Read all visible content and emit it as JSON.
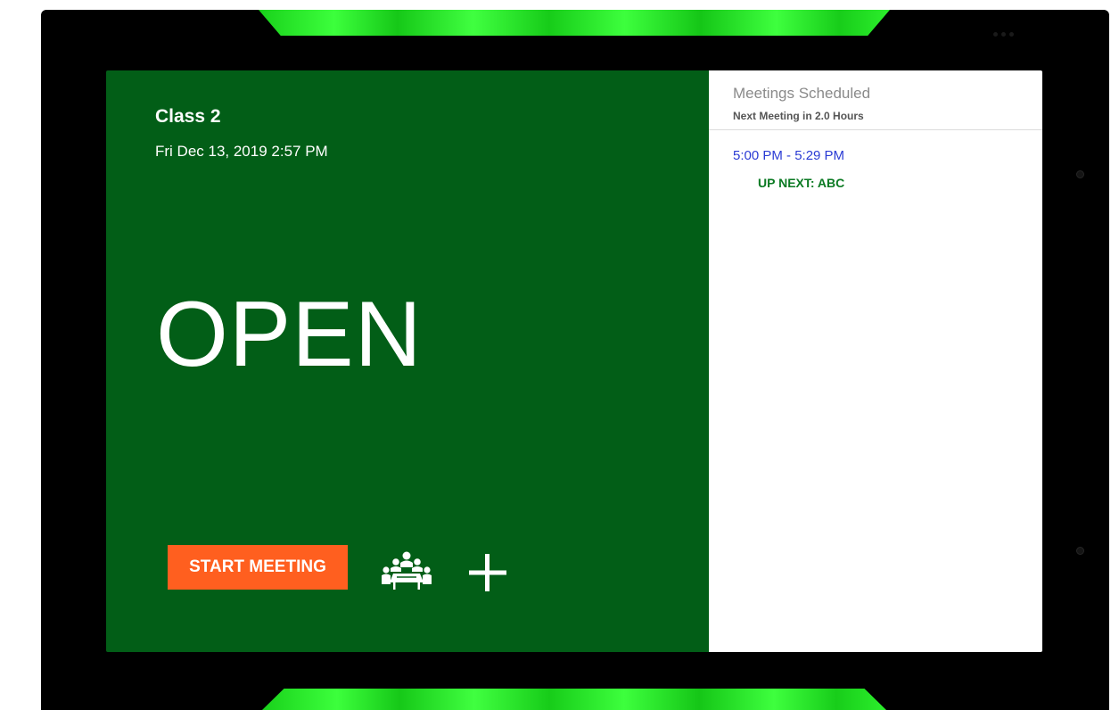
{
  "room": {
    "name": "Class 2",
    "datetime": "Fri Dec 13, 2019 2:57 PM",
    "status": "OPEN"
  },
  "actions": {
    "start_meeting_label": "START MEETING"
  },
  "icons": {
    "attendees": "meeting-attendees-icon",
    "add": "plus-icon"
  },
  "schedule": {
    "title": "Meetings Scheduled",
    "next_meeting": "Next Meeting in 2.0 Hours",
    "meetings": [
      {
        "time": "5:00 PM - 5:29 PM",
        "label": "UP NEXT: ABC"
      }
    ]
  },
  "colors": {
    "status_background": "#025e17",
    "start_button": "#ff5f1f",
    "led": "#2ef02e",
    "meeting_time": "#2a3bd4",
    "up_next": "#0b7a23"
  }
}
